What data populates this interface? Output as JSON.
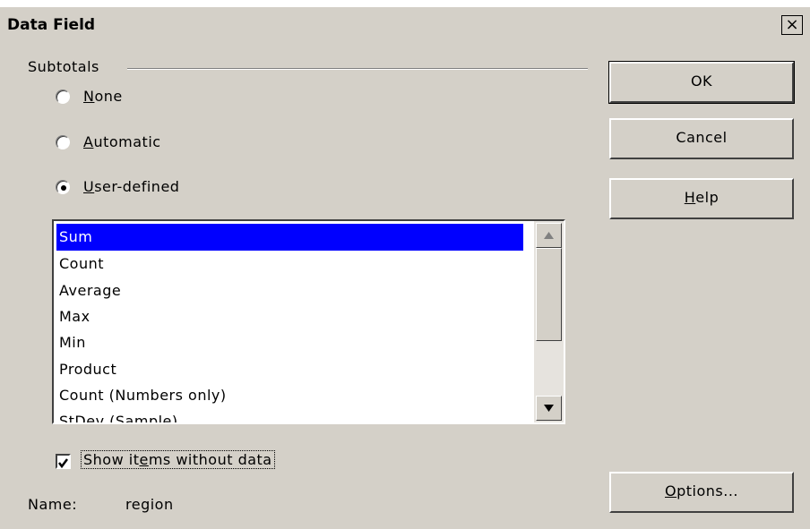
{
  "dialog": {
    "title": "Data Field",
    "close_glyph": "×"
  },
  "subtotals": {
    "group_label": "Subtotals",
    "options": [
      {
        "label_underlined": "N",
        "label_rest": "one",
        "selected": false
      },
      {
        "label_underlined": "A",
        "label_rest": "utomatic",
        "selected": false
      },
      {
        "label_underlined": "U",
        "label_rest": "ser-defined",
        "selected": true
      }
    ]
  },
  "functions_list": {
    "items": [
      "Sum",
      "Count",
      "Average",
      "Max",
      "Min",
      "Product",
      "Count (Numbers only)",
      "StDev (Sample)"
    ],
    "selected_index": 0
  },
  "show_items": {
    "label_before": "Show it",
    "label_underlined": "e",
    "label_after": "ms without data",
    "checked": true
  },
  "name": {
    "label": "Name:",
    "value": "region"
  },
  "buttons": {
    "ok": "OK",
    "cancel": "Cancel",
    "help_underlined": "H",
    "help_rest": "elp",
    "options_underlined": "O",
    "options_rest": "ptions..."
  },
  "icons": {
    "close": "close-icon",
    "scroll_up": "arrow-up-icon",
    "scroll_down": "arrow-down-icon",
    "check": "checkmark-icon"
  },
  "colors": {
    "dialog_bg": "#d4d0c8",
    "selection": "#0000ff"
  }
}
